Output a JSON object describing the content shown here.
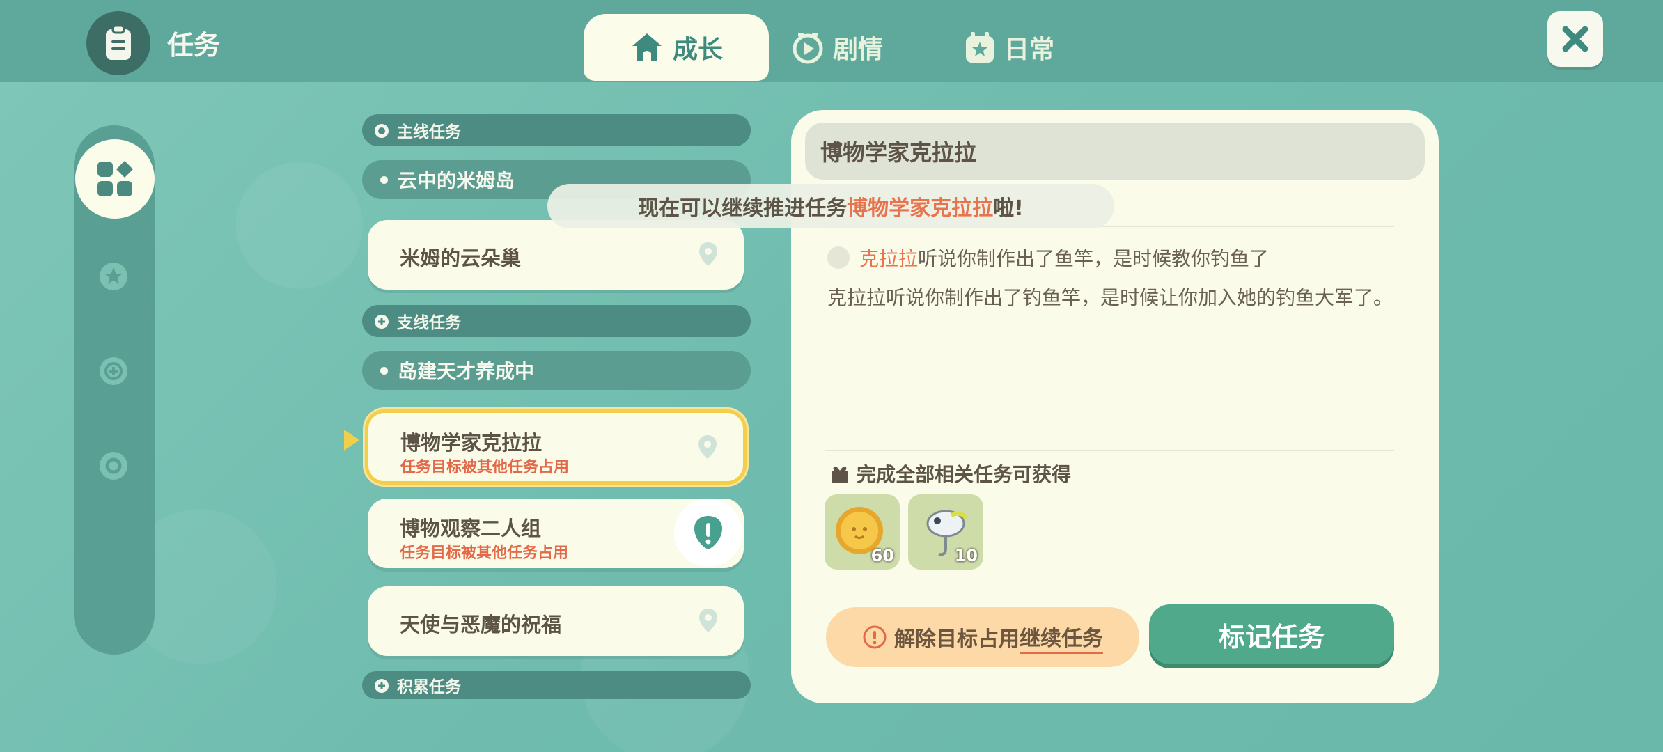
{
  "header": {
    "title": "任务",
    "tabs": [
      {
        "label": "成长",
        "active": true,
        "icon": "house-icon"
      },
      {
        "label": "剧情",
        "active": false,
        "icon": "play-clock-icon"
      },
      {
        "label": "日常",
        "active": false,
        "icon": "calendar-star-icon"
      }
    ]
  },
  "quest_list": {
    "main_section": "主线任务",
    "main_group": "云中的米姆岛",
    "main_quests": [
      {
        "name": "米姆的云朵巢",
        "status": ""
      }
    ],
    "side_section": "支线任务",
    "side_group": "岛建天才养成中",
    "side_quests": [
      {
        "name": "博物学家克拉拉",
        "status": "任务目标被其他任务占用"
      },
      {
        "name": "博物观察二人组",
        "status": "任务目标被其他任务占用"
      },
      {
        "name": "天使与恶魔的祝福",
        "status": ""
      }
    ],
    "accum_section": "积累任务"
  },
  "detail": {
    "title": "博物学家克拉拉",
    "objective_npc": "克拉拉",
    "objective_text": "听说你制作出了鱼竿，是时候教你钓鱼了",
    "description": "克拉拉听说你制作出了钓鱼竿，是时候让你加入她的钓鱼大军了。",
    "reward_title": "完成全部相关任务可获得",
    "rewards": [
      {
        "icon": "gold-coin-icon",
        "count": "60"
      },
      {
        "icon": "fishing-lure-icon",
        "count": "10"
      }
    ],
    "warn_prefix": "解除目标占用",
    "warn_link": "继续任务",
    "mark_button": "标记任务"
  },
  "toast": {
    "prefix": "现在可以继续推进任务",
    "highlight": "博物学家克拉拉",
    "suffix": "啦!"
  },
  "colors": {
    "background": "#72bfb0",
    "accent_orange": "#e8744d",
    "button_green": "#50a98a",
    "panel_cream": "#fbfbea"
  }
}
